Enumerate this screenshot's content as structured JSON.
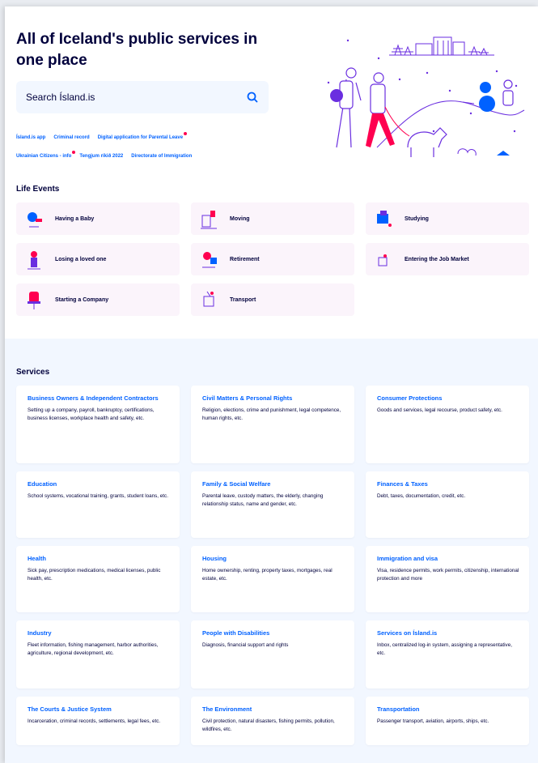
{
  "hero": {
    "title": "All of Iceland's public services in one place",
    "search_placeholder": "Search Ísland.is",
    "tags_row1": [
      {
        "label": "Ísland.is app",
        "dot": false
      },
      {
        "label": "Criminal record",
        "dot": false
      },
      {
        "label": "Digital application for Parental Leave",
        "dot": true
      }
    ],
    "tags_row2": [
      {
        "label": "Ukrainian Citizens - info",
        "dot": true
      },
      {
        "label": "Tengjum ríkið 2022",
        "dot": false
      },
      {
        "label": "Directorate of Immigration",
        "dot": false
      }
    ]
  },
  "life_events": {
    "title": "Life Events",
    "items": [
      {
        "label": "Having a Baby",
        "icon": "baby-icon"
      },
      {
        "label": "Moving",
        "icon": "moving-icon"
      },
      {
        "label": "Studying",
        "icon": "studying-icon"
      },
      {
        "label": "Losing a loved one",
        "icon": "loss-icon"
      },
      {
        "label": "Retirement",
        "icon": "retirement-icon"
      },
      {
        "label": "Entering the Job Market",
        "icon": "job-icon"
      },
      {
        "label": "Starting a Company",
        "icon": "company-icon"
      },
      {
        "label": "Transport",
        "icon": "transport-icon"
      }
    ]
  },
  "services": {
    "title": "Services",
    "items": [
      {
        "title": "Business Owners & Independent Contractors",
        "desc": "Setting up a company, payroll, bankruptcy, certifications, business licenses, workplace health and safety, etc."
      },
      {
        "title": "Civil Matters & Personal Rights",
        "desc": "Religion, elections, crime and punishment, legal competence, human rights, etc."
      },
      {
        "title": "Consumer Protections",
        "desc": "Goods and services, legal recourse, product safety, etc."
      },
      {
        "title": "Education",
        "desc": "School systems, vocational training, grants, student loans, etc."
      },
      {
        "title": "Family & Social Welfare",
        "desc": "Parental leave, custody matters, the elderly, changing relationship status, name and gender, etc."
      },
      {
        "title": "Finances & Taxes",
        "desc": "Debt, taxes, documentation, credit, etc."
      },
      {
        "title": "Health",
        "desc": "Sick pay, prescription medications, medical licenses, public health, etc."
      },
      {
        "title": "Housing",
        "desc": "Home ownership, renting, property taxes, mortgages, real estate, etc."
      },
      {
        "title": "Immigration and visa",
        "desc": "Visa, residence permits, work permits, citizenship, international protection and more"
      },
      {
        "title": "Industry",
        "desc": "Fleet information, fishing management, harbor authorities, agriculture, regional development, etc."
      },
      {
        "title": "People with Disabilities",
        "desc": "Diagnosis, financial support and rights"
      },
      {
        "title": "Services on Ísland.is",
        "desc": "Inbox, centralized log-in system, assigning a representative, etc."
      },
      {
        "title": "The Courts & Justice System",
        "desc": "Incarceration, criminal records, settlements, legal fees, etc."
      },
      {
        "title": "The Environment",
        "desc": "Civil protection, natural disasters, fishing permits, pollution, wildfires, etc."
      },
      {
        "title": "Transportation",
        "desc": "Passenger transport, aviation, airports, ships, etc."
      }
    ]
  },
  "colors": {
    "brand_blue": "#0061ff",
    "dark_navy": "#00003c",
    "purple": "#6a2ee0",
    "pink": "#ff0050",
    "life_card_bg": "#fbf4fb",
    "services_bg": "#f2f7ff"
  }
}
